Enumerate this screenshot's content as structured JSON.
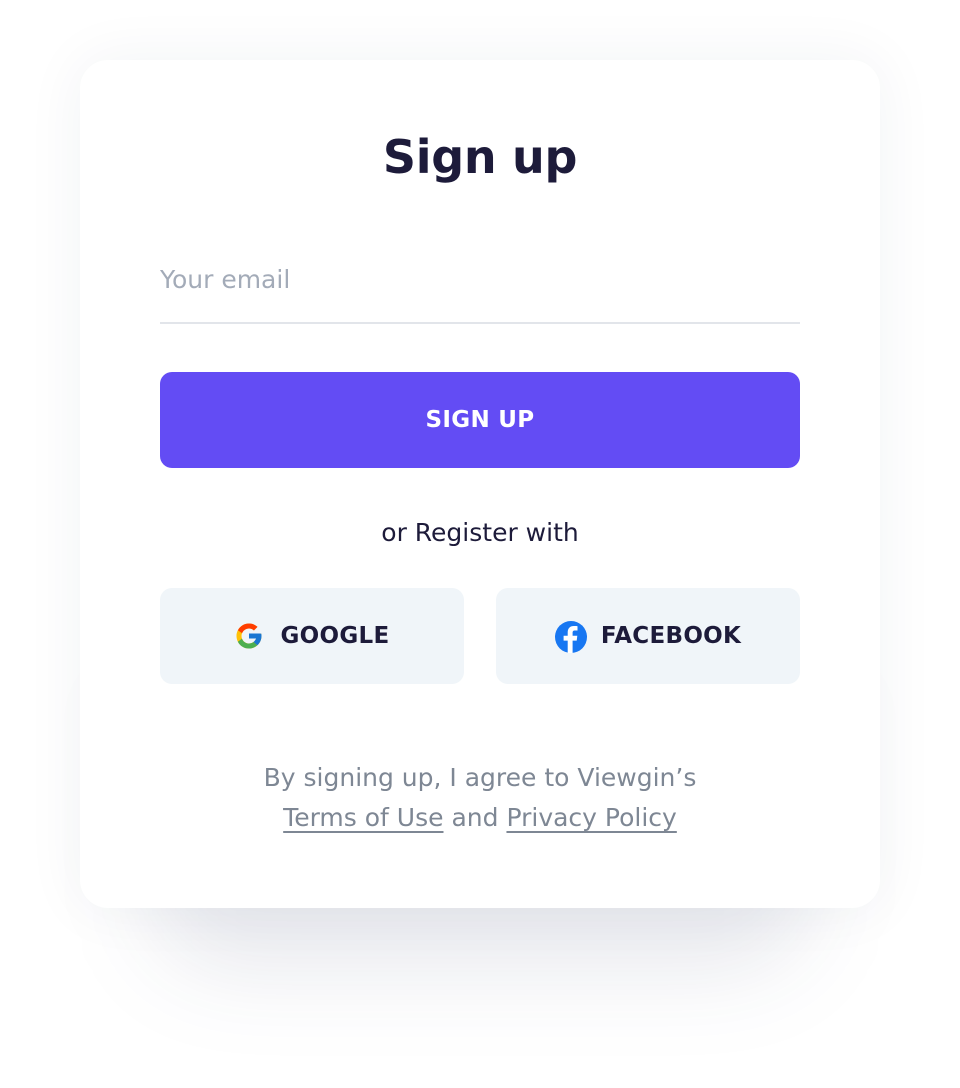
{
  "form": {
    "title": "Sign up",
    "email_placeholder": "Your email",
    "email_value": "",
    "submit_label": "SIGN UP",
    "divider_text": "or Register with"
  },
  "social": {
    "google_label": "GOOGLE",
    "google_icon": "google-icon",
    "facebook_label": "FACEBOOK",
    "facebook_icon": "facebook-icon"
  },
  "legal": {
    "line1": "By signing up, I agree to Viewgin’s",
    "terms_label": "Terms of Use",
    "and_text": "and",
    "privacy_label": "Privacy Policy"
  },
  "colors": {
    "accent": "#634CF4",
    "title_text": "#1D1B3A",
    "muted_text": "#7E8794",
    "social_bg": "#F0F5F9",
    "facebook_blue": "#1877F2"
  }
}
